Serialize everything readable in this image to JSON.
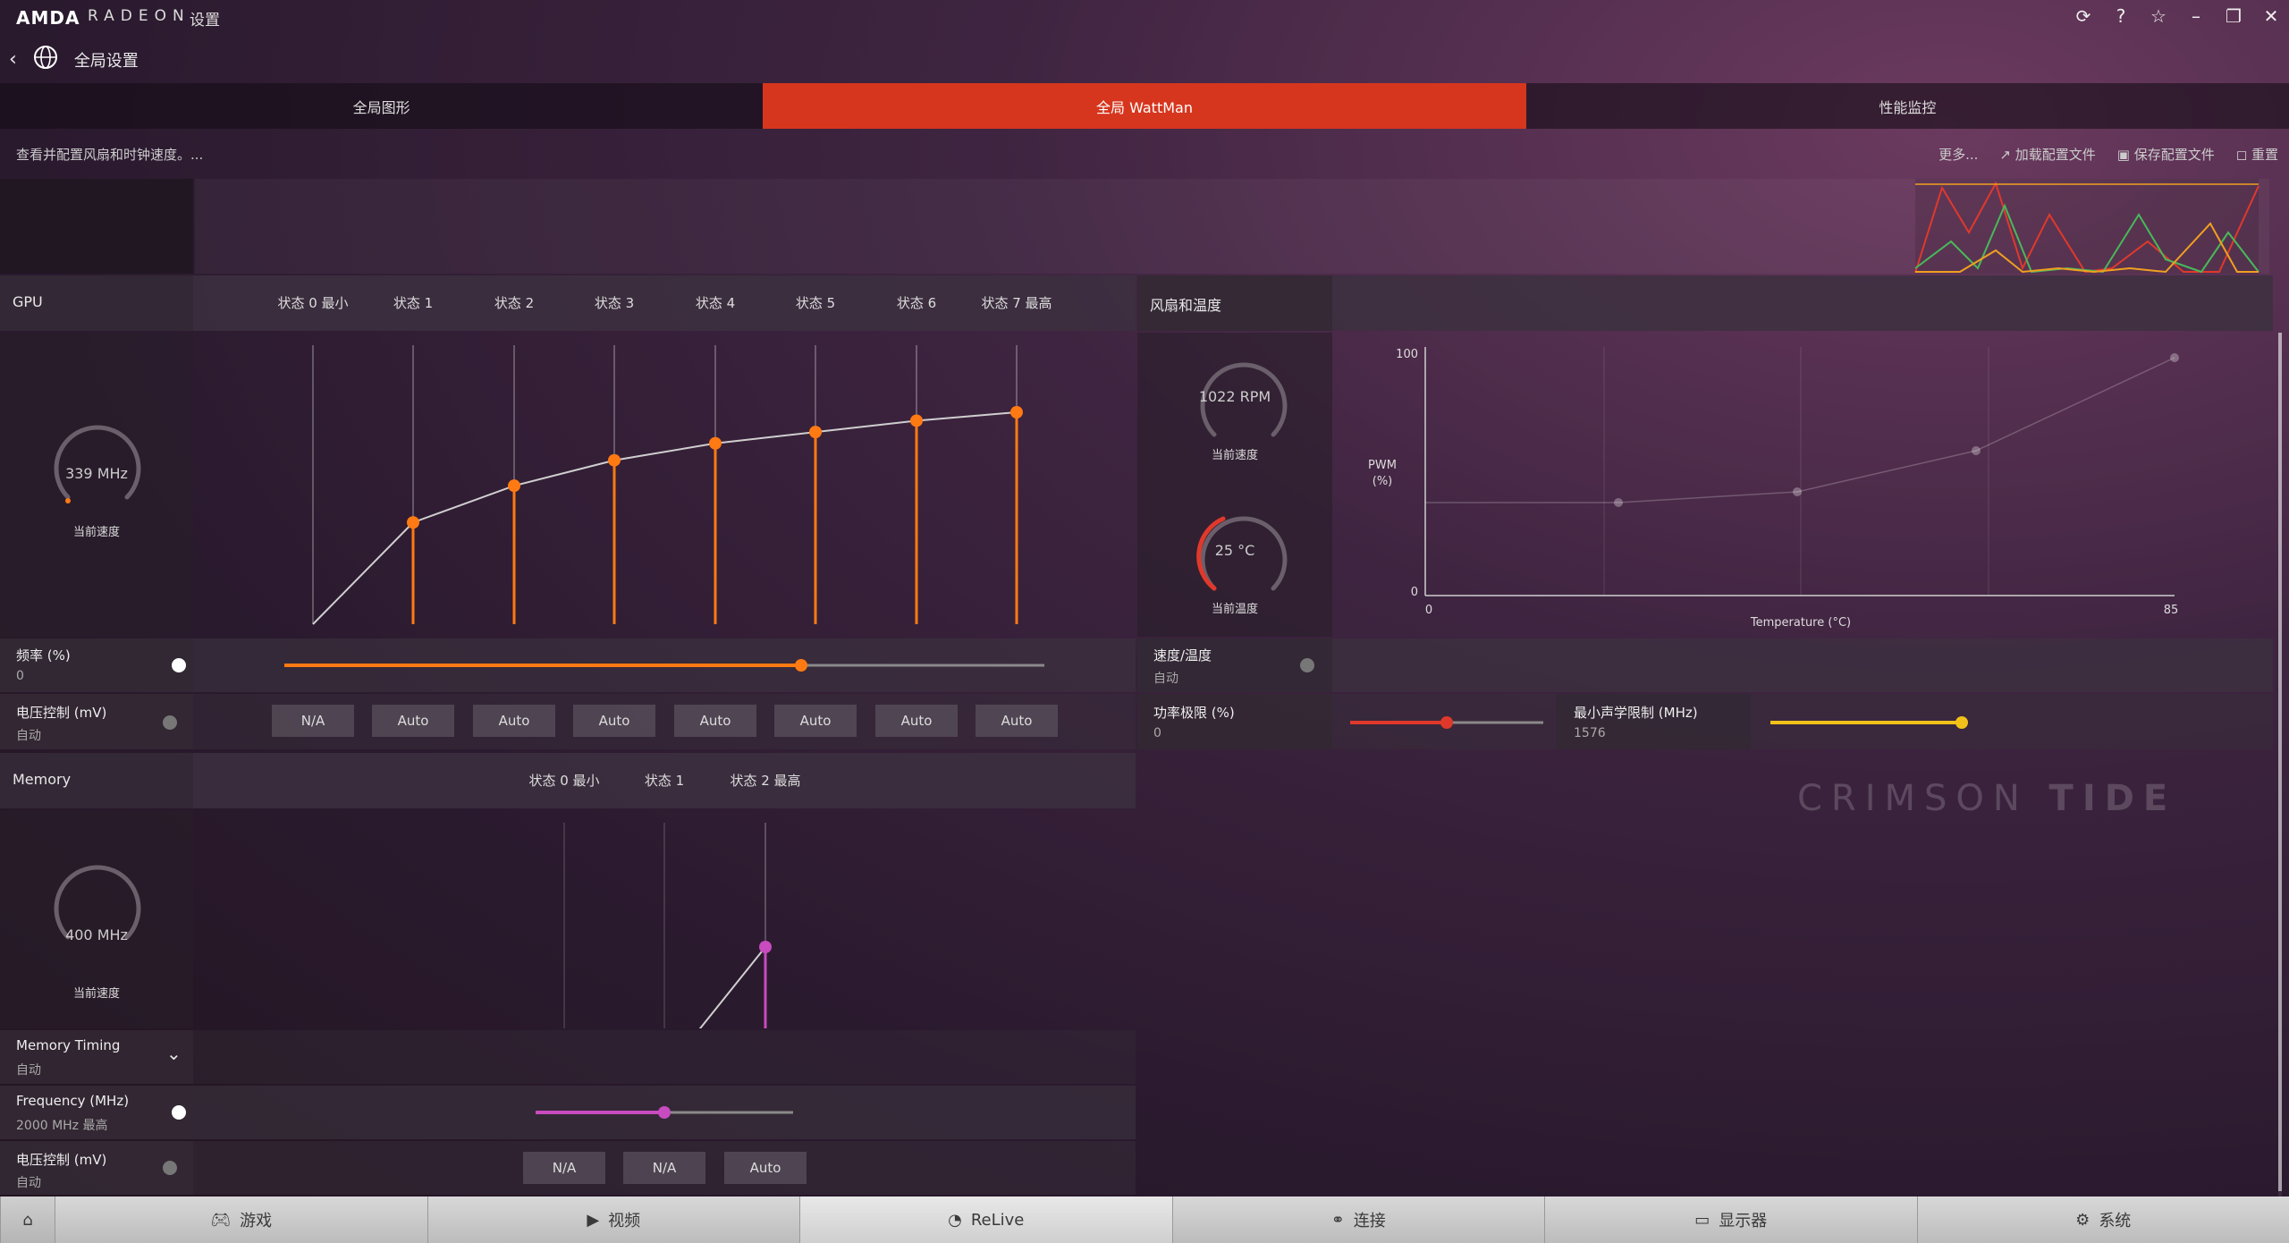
{
  "app": {
    "brand": "AMDA",
    "product": "RADEON",
    "settings_label": "设置"
  },
  "window_icons": [
    "update-icon",
    "help-icon",
    "star-icon",
    "minimize-icon",
    "restore-icon",
    "close-icon"
  ],
  "nav": {
    "title": "全局设置"
  },
  "tabs": [
    {
      "label": "全局图形",
      "active": false
    },
    {
      "label": "全局 WattMan",
      "active": true
    },
    {
      "label": "性能监控",
      "active": false
    }
  ],
  "subbar": {
    "description": "查看并配置风扇和时钟速度。...",
    "more": "更多...",
    "load_profile": "加载配置文件",
    "save_profile": "保存配置文件",
    "reset": "重置"
  },
  "gpu": {
    "header": "GPU",
    "states": [
      "状态 0 最小",
      "状态 1",
      "状态 2",
      "状态 3",
      "状态 4",
      "状态 5",
      "状态 6",
      "状态 7 最高"
    ],
    "current_speed": "339 MHz",
    "current_speed_label": "当前速度",
    "frequency_label": "频率 (%)",
    "frequency_value": "0",
    "frequency_slider_fraction": 0.68,
    "voltage_label": "电压控制 (mV)",
    "voltage_value": "自动",
    "voltage_buttons": [
      "N/A",
      "Auto",
      "Auto",
      "Auto",
      "Auto",
      "Auto",
      "Auto",
      "Auto"
    ],
    "curve_levels": [
      0.0,
      0.36,
      0.49,
      0.58,
      0.64,
      0.68,
      0.72,
      0.75
    ]
  },
  "fan": {
    "header": "风扇和温度",
    "rpm": "1022 RPM",
    "rpm_label": "当前速度",
    "temp": "25 °C",
    "temp_label": "当前温度",
    "chart": {
      "y_top": "100",
      "y_bottom": "0",
      "x_left": "0",
      "x_right": "85",
      "ylabel_line1": "PWM",
      "ylabel_line2": "(%)",
      "xlabel": "Temperature (°C)"
    },
    "speed_temp_label": "速度/温度",
    "speed_temp_value": "自动",
    "power_limit_label": "功率极限 (%)",
    "power_limit_value": "0",
    "power_limit_fraction": 0.5,
    "acoustic_label": "最小声学限制 (MHz)",
    "acoustic_value": "1576",
    "acoustic_fraction": 1.0
  },
  "memory": {
    "header": "Memory",
    "states": [
      "状态 0 最小",
      "状态 1",
      "状态 2 最高"
    ],
    "current_speed": "400 MHz",
    "current_speed_label": "当前速度",
    "timing_label": "Memory Timing",
    "timing_value": "自动",
    "frequency_label": "Frequency (MHz)",
    "frequency_value": "2000 MHz 最高",
    "frequency_fraction": 0.5,
    "voltage_label": "电压控制 (mV)",
    "voltage_value": "自动",
    "voltage_buttons": [
      "N/A",
      "N/A",
      "Auto"
    ]
  },
  "watermark": {
    "part1": "CRIMSON ",
    "part2": "TIDE"
  },
  "bottom_tabs": [
    {
      "label": "游戏",
      "icon": "gamepad-icon"
    },
    {
      "label": "视频",
      "icon": "play-icon"
    },
    {
      "label": "ReLive",
      "icon": "relive-icon"
    },
    {
      "label": "连接",
      "icon": "connect-icon"
    },
    {
      "label": "显示器",
      "icon": "monitor-icon"
    },
    {
      "label": "系统",
      "icon": "system-icon"
    }
  ],
  "colors": {
    "accent": "#d6361e",
    "orange": "#ff7a12",
    "magenta": "#c84bbf",
    "red": "#e0392b",
    "yellow": "#f2c21b"
  }
}
